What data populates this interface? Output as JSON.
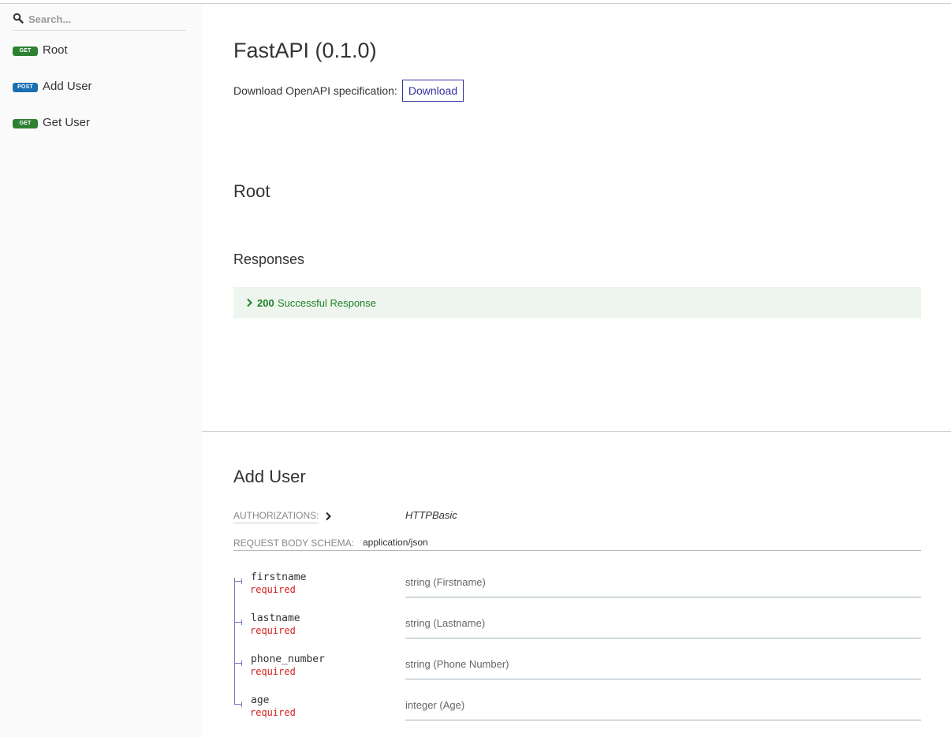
{
  "colors": {
    "get_badge": "#2f8132",
    "post_badge": "#186fb2",
    "link": "#32329f",
    "success": "#1d8127",
    "required": "#d41f1c",
    "sidebar_bg": "#fafafa"
  },
  "search": {
    "icon": "search-icon",
    "placeholder": "Search..."
  },
  "sidebar": {
    "items": [
      {
        "method": "GET",
        "label": "Root"
      },
      {
        "method": "POST",
        "label": "Add User"
      },
      {
        "method": "GET",
        "label": "Get User"
      }
    ]
  },
  "header": {
    "title": "FastAPI (0.1.0)",
    "download_text": "Download OpenAPI specification:",
    "download_button": "Download"
  },
  "root_section": {
    "title": "Root",
    "responses_title": "Responses",
    "response": {
      "code": "200",
      "text": "Successful Response"
    }
  },
  "add_user_section": {
    "title": "Add User",
    "authorizations_label": "AUTHORIZATIONS:",
    "authorizations_value": "HTTPBasic",
    "request_body_label": "REQUEST BODY SCHEMA:",
    "request_body_value": "application/json",
    "properties": [
      {
        "name": "firstname",
        "required": "required",
        "type": "string (Firstname)"
      },
      {
        "name": "lastname",
        "required": "required",
        "type": "string (Lastname)"
      },
      {
        "name": "phone_number",
        "required": "required",
        "type": "string (Phone Number)"
      },
      {
        "name": "age",
        "required": "required",
        "type": "integer (Age)"
      }
    ]
  }
}
